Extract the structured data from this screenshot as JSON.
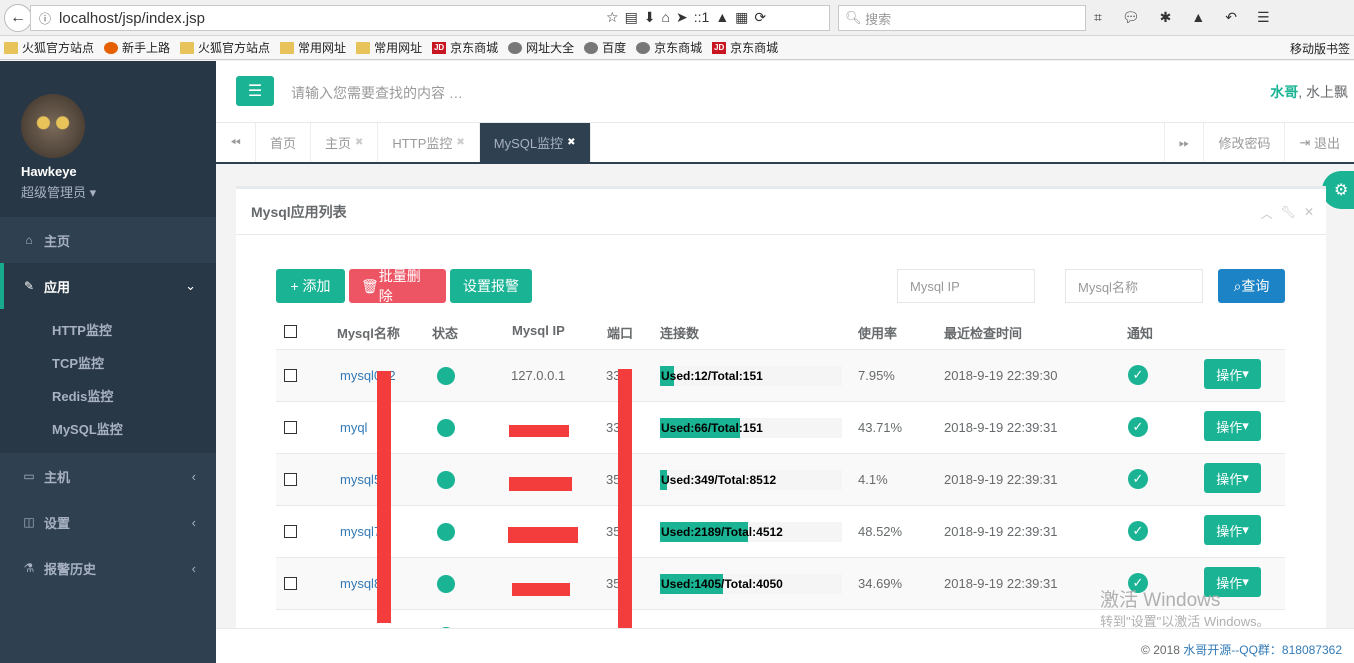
{
  "browser": {
    "url": "localhost/jsp/index.jsp",
    "zoom": "::1",
    "search_placeholder": "搜索",
    "bookmarks": [
      "火狐官方站点",
      "新手上路",
      "火狐官方站点",
      "常用网址",
      "常用网址",
      "京东商城",
      "网址大全",
      "百度",
      "京东商城",
      "京东商城"
    ],
    "bookmark_icons": [
      "folder",
      "fox",
      "folder",
      "folder",
      "folder",
      "jd",
      "globe",
      "globe",
      "globe",
      "jd"
    ],
    "mobile_bookmarks": "移动版书签"
  },
  "sidebar": {
    "user_name": "Hawkeye",
    "user_role": "超级管理员",
    "items": [
      {
        "label": "主页",
        "icon": "home-icon"
      },
      {
        "label": "应用",
        "icon": "edit-icon"
      },
      {
        "label": "主机",
        "icon": "desktop-icon"
      },
      {
        "label": "设置",
        "icon": "columns-icon"
      },
      {
        "label": "报警历史",
        "icon": "flask-icon"
      }
    ],
    "sub_items": [
      "HTTP监控",
      "TCP监控",
      "Redis监控",
      "MySQL监控"
    ]
  },
  "header": {
    "search_placeholder": "请输入您需要查找的内容 …",
    "user_highlight": "水哥",
    "user_rest": ", 水上飘"
  },
  "tabs": {
    "items": [
      "首页",
      "主页",
      "HTTP监控",
      "MySQL监控"
    ],
    "change_password": "修改密码",
    "logout": "退出"
  },
  "panel": {
    "title": "Mysql应用列表",
    "add": "添加",
    "batch_delete": "批量删除",
    "set_alarm": "设置报警",
    "ip_placeholder": "Mysql IP",
    "name_placeholder": "Mysql名称",
    "query": "查询"
  },
  "table": {
    "headers": [
      "Mysql名称",
      "状态",
      "Mysql IP",
      "端口",
      "连接数",
      "使用率",
      "最近检查时间",
      "通知"
    ],
    "rows": [
      {
        "name": "mysql012",
        "ip": "127.0.0.1",
        "port": "33",
        "conn": "Used:12/Total:151",
        "fill": 0.0795,
        "usage": "7.95%",
        "time": "2018-9-19 22:39:30",
        "op": "操作"
      },
      {
        "name": "myql",
        "ip": "",
        "port": "33",
        "conn": "Used:66/Total:151",
        "fill": 0.4371,
        "usage": "43.71%",
        "time": "2018-9-19 22:39:31",
        "op": "操作"
      },
      {
        "name": "mysql5",
        "ip": "",
        "port": "35",
        "conn": "Used:349/Total:8512",
        "fill": 0.041,
        "usage": "4.1%",
        "time": "2018-9-19 22:39:31",
        "op": "操作"
      },
      {
        "name": "mysql7",
        "ip": "",
        "port": "35",
        "conn": "Used:2189/Total:4512",
        "fill": 0.4852,
        "usage": "48.52%",
        "time": "2018-9-19 22:39:31",
        "op": "操作"
      },
      {
        "name": "mysql8",
        "ip": "",
        "port": "35",
        "conn": "Used:1405/Total:4050",
        "fill": 0.3469,
        "usage": "34.69%",
        "time": "2018-9-19 22:39:31",
        "op": "操作"
      }
    ]
  },
  "watermark": {
    "line1": "激活 Windows",
    "line2": "转到\"设置\"以激活 Windows。"
  },
  "footer": {
    "copyright": "© 2018",
    "brand": "水哥开源--QQ群：818087362"
  }
}
